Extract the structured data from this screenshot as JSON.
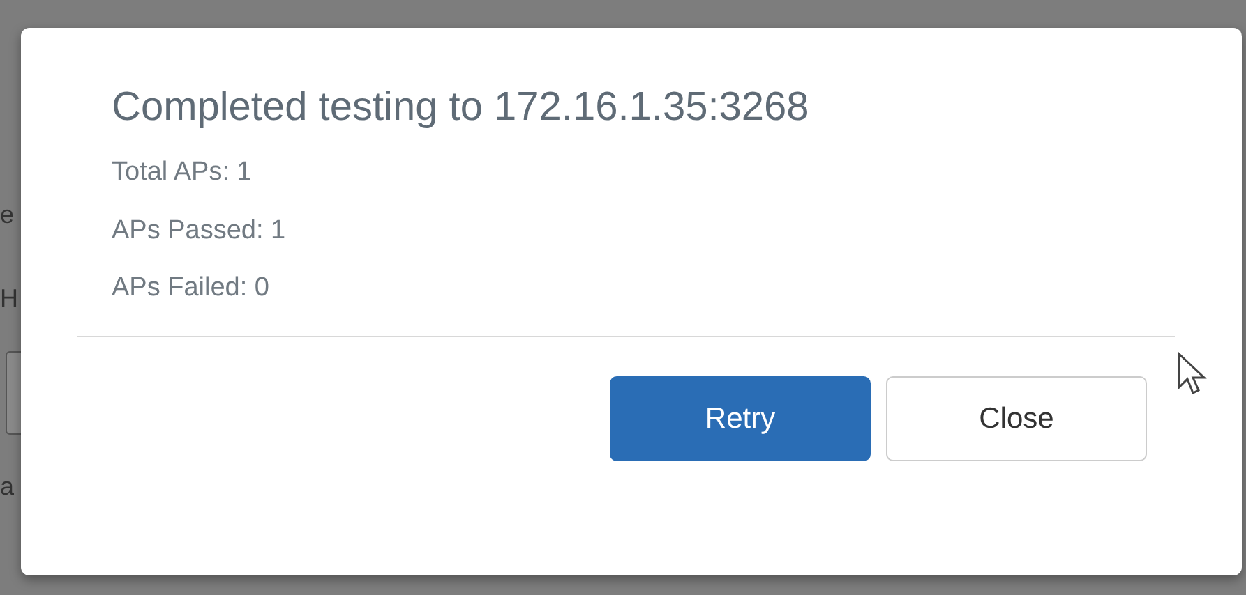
{
  "background": {
    "fragments": [
      "e",
      "H",
      "a"
    ]
  },
  "dialog": {
    "title": "Completed testing to 172.16.1.35:3268",
    "lines": [
      "Total APs: 1",
      "APs Passed: 1",
      "APs Failed: 0"
    ],
    "buttons": [
      {
        "label": "Retry",
        "kind": "primary"
      },
      {
        "label": "Close",
        "kind": "secondary"
      }
    ]
  }
}
